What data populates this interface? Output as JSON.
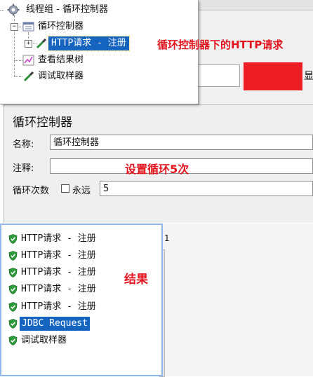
{
  "tree": {
    "items": [
      {
        "label": "线程组 - 循环控制器"
      },
      {
        "label": "循环控制器"
      },
      {
        "label": "HTTP请求 - 注册"
      },
      {
        "label": "查看结果树"
      },
      {
        "label": "调试取样器"
      }
    ]
  },
  "annotations": {
    "http_under_loop": "循环控制器下的HTTP请求",
    "set_loop": "设置循环5次",
    "result": "结果"
  },
  "background": {
    "partial_text": "显"
  },
  "loop_controller": {
    "title": "循环控制器",
    "name_label": "名称:",
    "name_value": "循环控制器",
    "comment_label": "注释:",
    "comment_value": "",
    "loops_label": "循环次数",
    "forever_label": "永远",
    "forever_checked": false,
    "loops_value": "5"
  },
  "results": {
    "items": [
      {
        "label": "HTTP请求 - 注册",
        "status": "success"
      },
      {
        "label": "HTTP请求 - 注册",
        "status": "success"
      },
      {
        "label": "HTTP请求 - 注册",
        "status": "success"
      },
      {
        "label": "HTTP请求 - 注册",
        "status": "success"
      },
      {
        "label": "HTTP请求 - 注册",
        "status": "success"
      },
      {
        "label": "JDBC Request",
        "status": "success",
        "selected": true
      },
      {
        "label": "调试取样器",
        "status": "success"
      }
    ],
    "right_edge_text": "1"
  },
  "colors": {
    "annotation": "#e3141e",
    "selection": "#1565c0",
    "success": "#2e9b3a",
    "mask": "#ee1c25"
  }
}
